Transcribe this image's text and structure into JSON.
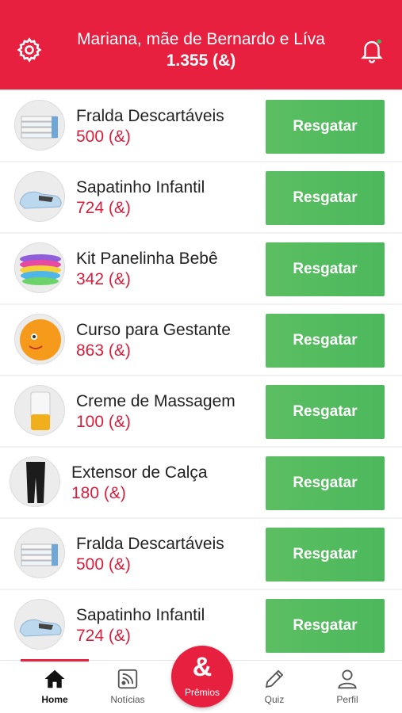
{
  "header": {
    "title": "Mariana, mãe de Bernardo e Líva",
    "points": "1.355 (&)"
  },
  "items": [
    {
      "name": "Fralda Descartáveis",
      "price": "500 (&)",
      "button": "Resgatar",
      "image": "diapers"
    },
    {
      "name": "Sapatinho Infantil",
      "price": "724 (&)",
      "button": "Resgatar",
      "image": "baby-shoe"
    },
    {
      "name": "Kit Panelinha Bebê",
      "price": "342 (&)",
      "button": "Resgatar",
      "image": "bowls"
    },
    {
      "name": "Curso para Gestante",
      "price": "863 (&)",
      "button": "Resgatar",
      "image": "orange-ball"
    },
    {
      "name": "Creme de Massagem",
      "price": "100 (&)",
      "button": "Resgatar",
      "image": "cream-bottle"
    },
    {
      "name": "Extensor de Calça",
      "price": "180 (&)",
      "button": "Resgatar",
      "image": "leggings"
    },
    {
      "name": "Fralda Descartáveis",
      "price": "500 (&)",
      "button": "Resgatar",
      "image": "diapers"
    },
    {
      "name": "Sapatinho Infantil",
      "price": "724 (&)",
      "button": "Resgatar",
      "image": "baby-shoe"
    }
  ],
  "tabs": {
    "home": "Home",
    "noticias": "Notícias",
    "premios": "Prêmios",
    "premios_glyph": "&",
    "quiz": "Quiz",
    "perfil": "Perfil"
  },
  "colors": {
    "brand": "#e8203f",
    "button": "#4cb85c",
    "price": "#d81e3c"
  }
}
